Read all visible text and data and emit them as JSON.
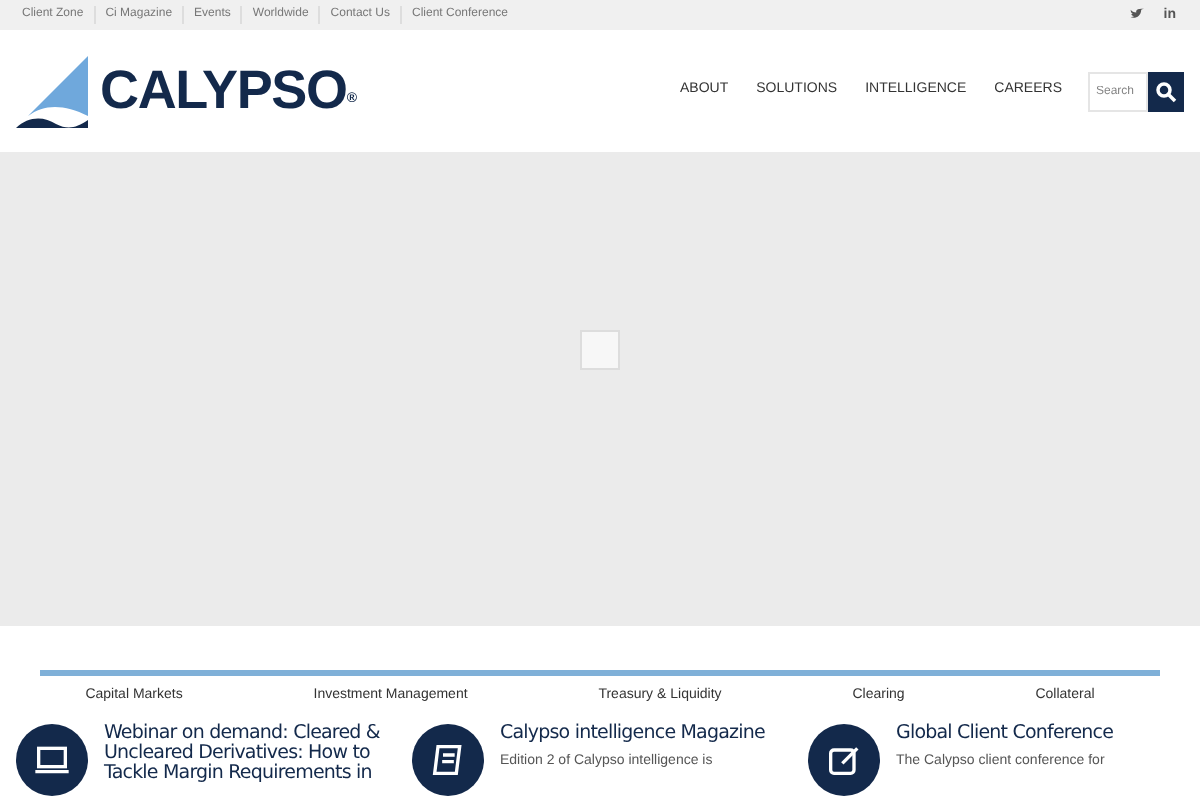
{
  "top_links": [
    "Client Zone",
    "Ci Magazine",
    "Events",
    "Worldwide",
    "Contact Us",
    "Client Conference"
  ],
  "linkedin": "in",
  "logo": {
    "text": "CALYPSO",
    "mark": "®"
  },
  "nav": [
    "ABOUT",
    "SOLUTIONS",
    "INTELLIGENCE",
    "CAREERS"
  ],
  "search": {
    "placeholder": "Search"
  },
  "tabs": [
    "Capital Markets",
    "Investment Management",
    "Treasury & Liquidity",
    "Clearing",
    "Collateral"
  ],
  "cards": [
    {
      "kind": "laptop",
      "title": "Webinar on demand: Cleared & Uncleared Derivatives: How to Tackle Margin Requirements in"
    },
    {
      "kind": "book",
      "title": "Calypso intelligence Magazine",
      "text": "Edition 2 of Calypso intelligence is"
    },
    {
      "kind": "edit",
      "title": "Global Client Conference",
      "text": "The Calypso client conference for"
    }
  ]
}
